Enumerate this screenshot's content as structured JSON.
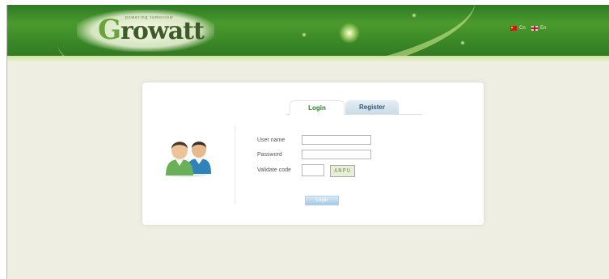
{
  "header": {
    "logo_initial": "G",
    "logo_rest": "rowatt",
    "tagline": "powering tomorrow",
    "languages": [
      {
        "label": "Cn",
        "icon": "china-flag-icon"
      },
      {
        "label": "En",
        "icon": "uk-flag-icon"
      }
    ]
  },
  "tabs": {
    "login": "Login",
    "register": "Register",
    "active": "Login"
  },
  "form": {
    "username_label": "User name",
    "password_label": "Password",
    "validate_label": "Validate code",
    "username_value": "",
    "password_value": "",
    "validate_value": "",
    "captcha_text": "ANPU",
    "login_button": "Login"
  },
  "colors": {
    "header_green": "#3a8727",
    "page_background": "#efeee3",
    "login_tab_text": "#2c7e2c",
    "register_tab_text": "#35557a"
  },
  "icons": {
    "avatar": "users-avatar-icon"
  }
}
